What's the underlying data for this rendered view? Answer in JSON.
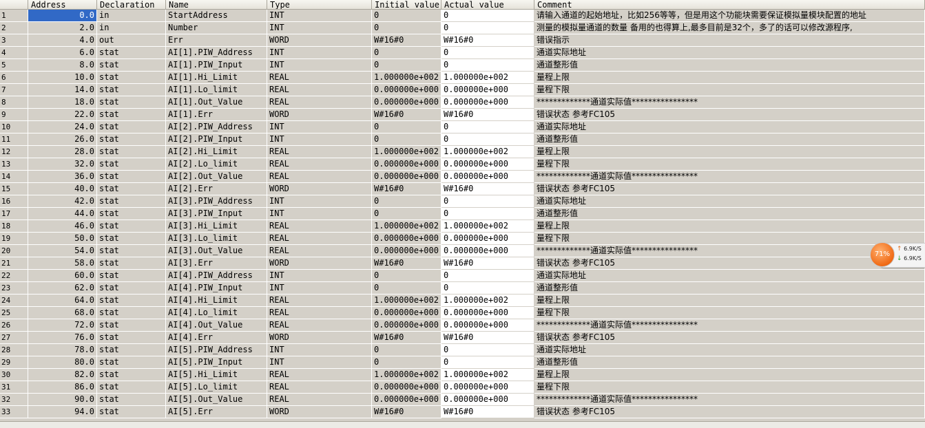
{
  "columns": {
    "address": "Address",
    "declaration": "Declaration",
    "name": "Name",
    "type": "Type",
    "initial": "Initial value",
    "actual": "Actual value",
    "comment": "Comment"
  },
  "rows": [
    {
      "n": "1",
      "address": "0.0",
      "decl": "in",
      "name": "StartAddress",
      "type": "INT",
      "initial": "0",
      "actual": "0",
      "comment": "请输入通道的起始地址，比如256等等，但是用这个功能块需要保证模拟量模块配置的地址"
    },
    {
      "n": "2",
      "address": "2.0",
      "decl": "in",
      "name": "Number",
      "type": "INT",
      "initial": "0",
      "actual": "0",
      "comment": "测量的模拟量通道的数量 备用的也得算上,最多目前是32个，多了的话可以修改源程序,"
    },
    {
      "n": "3",
      "address": "4.0",
      "decl": "out",
      "name": "Err",
      "type": "WORD",
      "initial": "W#16#0",
      "actual": "W#16#0",
      "comment": "错误指示"
    },
    {
      "n": "4",
      "address": "6.0",
      "decl": "stat",
      "name": "AI[1].PIW_Address",
      "type": "INT",
      "initial": "0",
      "actual": "0",
      "comment": "通道实际地址"
    },
    {
      "n": "5",
      "address": "8.0",
      "decl": "stat",
      "name": "AI[1].PIW_Input",
      "type": "INT",
      "initial": "0",
      "actual": "0",
      "comment": "通道整形值"
    },
    {
      "n": "6",
      "address": "10.0",
      "decl": "stat",
      "name": "AI[1].Hi_Limit",
      "type": "REAL",
      "initial": "1.000000e+002",
      "actual": "1.000000e+002",
      "comment": "量程上限"
    },
    {
      "n": "7",
      "address": "14.0",
      "decl": "stat",
      "name": "AI[1].Lo_limit",
      "type": "REAL",
      "initial": "0.000000e+000",
      "actual": "0.000000e+000",
      "comment": "量程下限"
    },
    {
      "n": "8",
      "address": "18.0",
      "decl": "stat",
      "name": "AI[1].Out_Value",
      "type": "REAL",
      "initial": "0.000000e+000",
      "actual": "0.000000e+000",
      "comment": "*************通道实际值****************"
    },
    {
      "n": "9",
      "address": "22.0",
      "decl": "stat",
      "name": "AI[1].Err",
      "type": "WORD",
      "initial": "W#16#0",
      "actual": "W#16#0",
      "comment": "错误状态 参考FC105"
    },
    {
      "n": "10",
      "address": "24.0",
      "decl": "stat",
      "name": "AI[2].PIW_Address",
      "type": "INT",
      "initial": "0",
      "actual": "0",
      "comment": "通道实际地址"
    },
    {
      "n": "11",
      "address": "26.0",
      "decl": "stat",
      "name": "AI[2].PIW_Input",
      "type": "INT",
      "initial": "0",
      "actual": "0",
      "comment": "通道整形值"
    },
    {
      "n": "12",
      "address": "28.0",
      "decl": "stat",
      "name": "AI[2].Hi_Limit",
      "type": "REAL",
      "initial": "1.000000e+002",
      "actual": "1.000000e+002",
      "comment": "量程上限"
    },
    {
      "n": "13",
      "address": "32.0",
      "decl": "stat",
      "name": "AI[2].Lo_limit",
      "type": "REAL",
      "initial": "0.000000e+000",
      "actual": "0.000000e+000",
      "comment": "量程下限"
    },
    {
      "n": "14",
      "address": "36.0",
      "decl": "stat",
      "name": "AI[2].Out_Value",
      "type": "REAL",
      "initial": "0.000000e+000",
      "actual": "0.000000e+000",
      "comment": "*************通道实际值****************"
    },
    {
      "n": "15",
      "address": "40.0",
      "decl": "stat",
      "name": "AI[2].Err",
      "type": "WORD",
      "initial": "W#16#0",
      "actual": "W#16#0",
      "comment": "错误状态 参考FC105"
    },
    {
      "n": "16",
      "address": "42.0",
      "decl": "stat",
      "name": "AI[3].PIW_Address",
      "type": "INT",
      "initial": "0",
      "actual": "0",
      "comment": "通道实际地址"
    },
    {
      "n": "17",
      "address": "44.0",
      "decl": "stat",
      "name": "AI[3].PIW_Input",
      "type": "INT",
      "initial": "0",
      "actual": "0",
      "comment": "通道整形值"
    },
    {
      "n": "18",
      "address": "46.0",
      "decl": "stat",
      "name": "AI[3].Hi_Limit",
      "type": "REAL",
      "initial": "1.000000e+002",
      "actual": "1.000000e+002",
      "comment": "量程上限"
    },
    {
      "n": "19",
      "address": "50.0",
      "decl": "stat",
      "name": "AI[3].Lo_limit",
      "type": "REAL",
      "initial": "0.000000e+000",
      "actual": "0.000000e+000",
      "comment": "量程下限"
    },
    {
      "n": "20",
      "address": "54.0",
      "decl": "stat",
      "name": "AI[3].Out_Value",
      "type": "REAL",
      "initial": "0.000000e+000",
      "actual": "0.000000e+000",
      "comment": "*************通道实际值****************"
    },
    {
      "n": "21",
      "address": "58.0",
      "decl": "stat",
      "name": "AI[3].Err",
      "type": "WORD",
      "initial": "W#16#0",
      "actual": "W#16#0",
      "comment": "错误状态 参考FC105"
    },
    {
      "n": "22",
      "address": "60.0",
      "decl": "stat",
      "name": "AI[4].PIW_Address",
      "type": "INT",
      "initial": "0",
      "actual": "0",
      "comment": "通道实际地址"
    },
    {
      "n": "23",
      "address": "62.0",
      "decl": "stat",
      "name": "AI[4].PIW_Input",
      "type": "INT",
      "initial": "0",
      "actual": "0",
      "comment": "通道整形值"
    },
    {
      "n": "24",
      "address": "64.0",
      "decl": "stat",
      "name": "AI[4].Hi_Limit",
      "type": "REAL",
      "initial": "1.000000e+002",
      "actual": "1.000000e+002",
      "comment": "量程上限"
    },
    {
      "n": "25",
      "address": "68.0",
      "decl": "stat",
      "name": "AI[4].Lo_limit",
      "type": "REAL",
      "initial": "0.000000e+000",
      "actual": "0.000000e+000",
      "comment": "量程下限"
    },
    {
      "n": "26",
      "address": "72.0",
      "decl": "stat",
      "name": "AI[4].Out_Value",
      "type": "REAL",
      "initial": "0.000000e+000",
      "actual": "0.000000e+000",
      "comment": "*************通道实际值****************"
    },
    {
      "n": "27",
      "address": "76.0",
      "decl": "stat",
      "name": "AI[4].Err",
      "type": "WORD",
      "initial": "W#16#0",
      "actual": "W#16#0",
      "comment": "错误状态 参考FC105"
    },
    {
      "n": "28",
      "address": "78.0",
      "decl": "stat",
      "name": "AI[5].PIW_Address",
      "type": "INT",
      "initial": "0",
      "actual": "0",
      "comment": "通道实际地址"
    },
    {
      "n": "29",
      "address": "80.0",
      "decl": "stat",
      "name": "AI[5].PIW_Input",
      "type": "INT",
      "initial": "0",
      "actual": "0",
      "comment": "通道整形值"
    },
    {
      "n": "30",
      "address": "82.0",
      "decl": "stat",
      "name": "AI[5].Hi_Limit",
      "type": "REAL",
      "initial": "1.000000e+002",
      "actual": "1.000000e+002",
      "comment": "量程上限"
    },
    {
      "n": "31",
      "address": "86.0",
      "decl": "stat",
      "name": "AI[5].Lo_limit",
      "type": "REAL",
      "initial": "0.000000e+000",
      "actual": "0.000000e+000",
      "comment": "量程下限"
    },
    {
      "n": "32",
      "address": "90.0",
      "decl": "stat",
      "name": "AI[5].Out_Value",
      "type": "REAL",
      "initial": "0.000000e+000",
      "actual": "0.000000e+000",
      "comment": "*************通道实际值****************"
    },
    {
      "n": "33",
      "address": "94.0",
      "decl": "stat",
      "name": "AI[5].Err",
      "type": "WORD",
      "initial": "W#16#0",
      "actual": "W#16#0",
      "comment": "错误状态 参考FC105"
    }
  ],
  "selected_row": "1",
  "net_widget": {
    "percent": "71%",
    "up_speed": "6.9K/S",
    "down_speed": "6.9K/S",
    "up_arrow": "↑",
    "down_arrow": "↓",
    "ball_color": "#f06a14"
  }
}
